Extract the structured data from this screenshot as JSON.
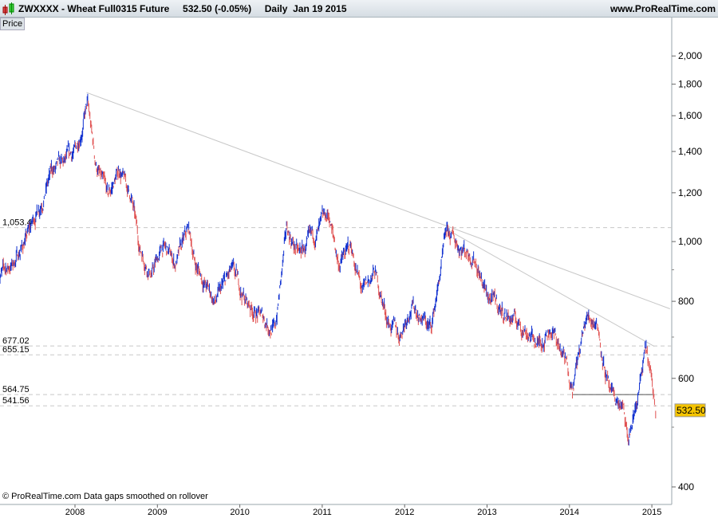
{
  "header": {
    "title": "ZWXXXX - Wheat Full0315 Future     532.50 (-0.05%)     Daily  Jan 19 2015",
    "site": "www.ProRealTime.com"
  },
  "price_tab": "Price",
  "footer": "© ProRealTime.com  Data gaps smoothed on rollover",
  "colors": {
    "up": "#1030d0",
    "down": "#e05050",
    "last": "#f5c400"
  },
  "chart_data": {
    "type": "line",
    "scale": "log",
    "title": "ZWXXXX - Wheat Full0315 Future",
    "ylabel": "Price",
    "ylim": [
      380,
      2300
    ],
    "xlim": [
      2007.0,
      2015.27
    ],
    "x_ticks": [
      2008,
      2009,
      2010,
      2011,
      2012,
      2013,
      2014,
      2015
    ],
    "x_tick_labels": [
      "2008",
      "2009",
      "2010",
      "2011",
      "2012",
      "2013",
      "2014",
      "2015"
    ],
    "y_ticks": [
      400,
      600,
      800,
      1000,
      1200,
      1400,
      1600,
      1800,
      2000
    ],
    "y_tick_labels": [
      "400",
      "600",
      "800",
      "1,000",
      "1,200",
      "1,400",
      "1,600",
      "1,800",
      "2,000"
    ],
    "last_price": "532.50",
    "levels": [
      {
        "value": 1053.4,
        "label": "1,053.4"
      },
      {
        "value": 677.02,
        "label": "677.02"
      },
      {
        "value": 655.15,
        "label": "655.15"
      },
      {
        "value": 564.75,
        "label": "564.75"
      },
      {
        "value": 541.56,
        "label": "541.56"
      }
    ],
    "trendlines": [
      {
        "from": [
          2008.14,
          1745
        ],
        "to": [
          2015.22,
          778
        ]
      },
      {
        "from": [
          2012.51,
          1047
        ],
        "to": [
          2015.03,
          676
        ]
      },
      {
        "from": [
          2014.04,
          564.75
        ],
        "to": [
          2015.03,
          564.75
        ]
      }
    ],
    "series": [
      {
        "name": "Price",
        "x": [
          2007.07,
          2007.25,
          2007.45,
          2007.72,
          2007.86,
          2008.01,
          2008.15,
          2008.25,
          2008.4,
          2008.54,
          2008.69,
          2008.78,
          2008.93,
          2009.07,
          2009.22,
          2009.38,
          2009.46,
          2009.7,
          2009.9,
          2010.09,
          2010.28,
          2010.43,
          2010.57,
          2010.72,
          2010.91,
          2011.08,
          2011.2,
          2011.35,
          2011.49,
          2011.64,
          2011.79,
          2011.93,
          2012.08,
          2012.32,
          2012.51,
          2012.7,
          2012.85,
          2012.99,
          2013.19,
          2013.48,
          2013.62,
          2013.77,
          2013.87,
          2014.04,
          2014.21,
          2014.33,
          2014.5,
          2014.64,
          2014.71,
          2014.79,
          2014.93,
          2015.05
        ],
        "y": [
          883,
          920,
          1040,
          1300,
          1320,
          1400,
          1673,
          1340,
          1170,
          1310,
          1170,
          980,
          890,
          980,
          920,
          1040,
          920,
          795,
          890,
          795,
          750,
          720,
          1040,
          950,
          1010,
          1100,
          920,
          980,
          820,
          890,
          750,
          700,
          795,
          720,
          1025,
          980,
          950,
          820,
          770,
          720,
          680,
          730,
          680,
          590,
          750,
          750,
          555,
          540,
          470,
          525,
          665,
          532
        ]
      }
    ]
  }
}
